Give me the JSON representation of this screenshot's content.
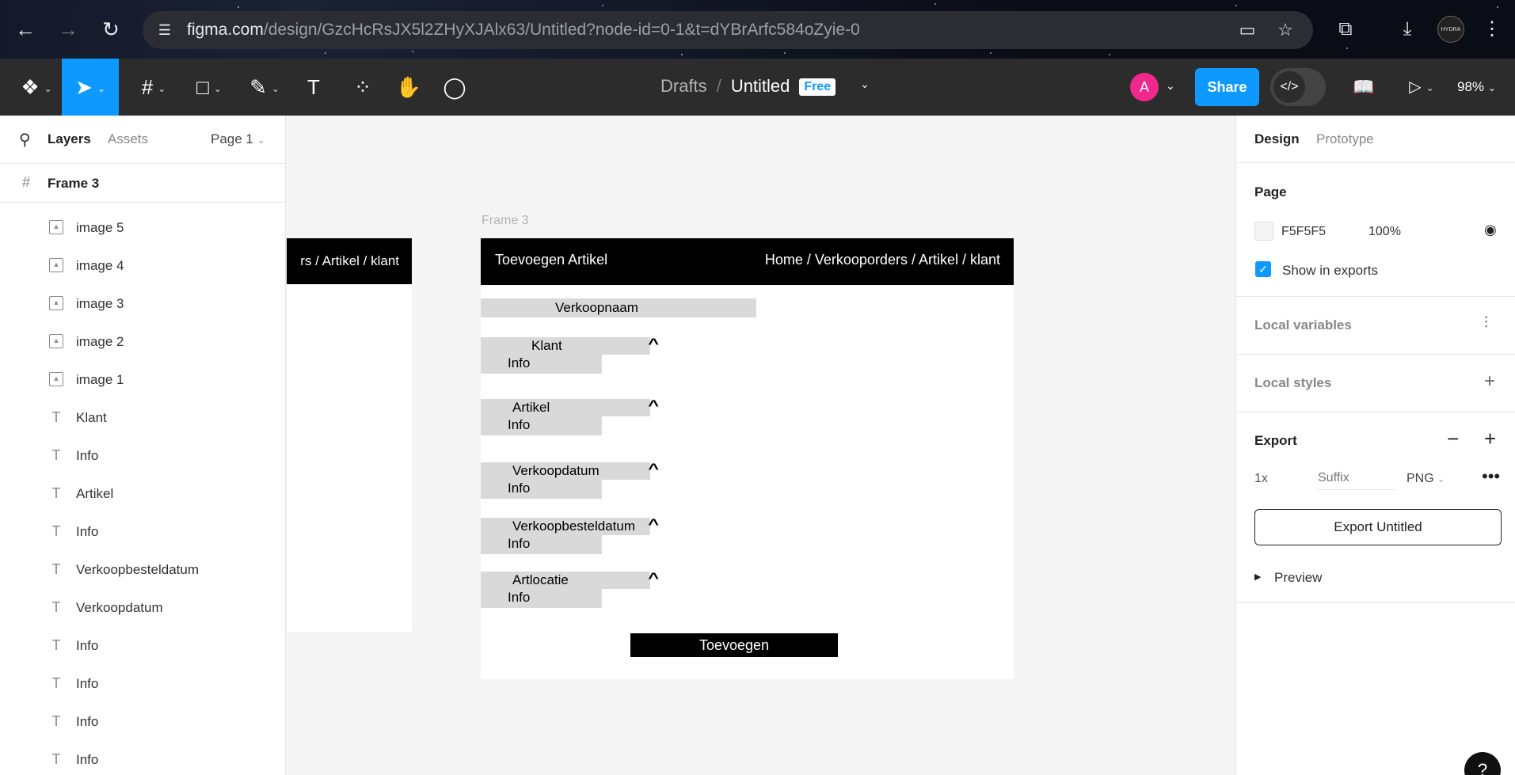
{
  "browser": {
    "url_host": "figma.com",
    "url_path": "/design/GzcHcRsJX5l2ZHyXJAlx63/Untitled?node-id=0-1&t=dYBrArfc584oZyie-0",
    "profile_label": "HYDRA"
  },
  "toolbar": {
    "breadcrumb_drafts": "Drafts",
    "breadcrumb_sep": "/",
    "file_name": "Untitled",
    "plan_badge": "Free",
    "user_initial": "A",
    "share_label": "Share",
    "zoom": "98%"
  },
  "left_panel": {
    "tab_layers": "Layers",
    "tab_assets": "Assets",
    "page_select": "Page 1",
    "frame_name": "Frame 3",
    "layers": [
      {
        "type": "image",
        "label": "image 5"
      },
      {
        "type": "image",
        "label": "image 4"
      },
      {
        "type": "image",
        "label": "image 3"
      },
      {
        "type": "image",
        "label": "image 2"
      },
      {
        "type": "image",
        "label": "image 1"
      },
      {
        "type": "text",
        "label": "Klant"
      },
      {
        "type": "text",
        "label": "Info"
      },
      {
        "type": "text",
        "label": "Artikel"
      },
      {
        "type": "text",
        "label": "Info"
      },
      {
        "type": "text",
        "label": "Verkoopbesteldatum"
      },
      {
        "type": "text",
        "label": "Verkoopdatum"
      },
      {
        "type": "text",
        "label": "Info"
      },
      {
        "type": "text",
        "label": "Info"
      },
      {
        "type": "text",
        "label": "Info"
      },
      {
        "type": "text",
        "label": "Info"
      }
    ]
  },
  "canvas": {
    "partial_frame_crumb": "rs / Artikel / klant",
    "frame_label": "Frame 3",
    "frame": {
      "title": "Toevoegen Artikel",
      "crumb": "Home / Verkooporders / Artikel / klant",
      "verkoopnaam": "Verkoopnaam",
      "fields": [
        {
          "label": "Klant",
          "info": "Info"
        },
        {
          "label": "Artikel",
          "info": "Info"
        },
        {
          "label": "Verkoopdatum",
          "info": "Info"
        },
        {
          "label": "Verkoopbesteldatum",
          "info": "Info"
        },
        {
          "label": "Artlocatie",
          "info": "Info"
        }
      ],
      "button": "Toevoegen"
    }
  },
  "right_panel": {
    "tab_design": "Design",
    "tab_prototype": "Prototype",
    "page_title": "Page",
    "page_color": "F5F5F5",
    "page_opacity": "100%",
    "show_in_exports": "Show in exports",
    "local_variables": "Local variables",
    "local_styles": "Local styles",
    "export_title": "Export",
    "export_scale": "1x",
    "export_suffix_placeholder": "Suffix",
    "export_format": "PNG",
    "export_button": "Export Untitled",
    "preview": "Preview"
  },
  "colors": {
    "accent": "#0d99ff",
    "toolbar_bg": "#2c2c2c",
    "canvas_bg": "#f5f5f5",
    "avatar": "#f0288c"
  }
}
